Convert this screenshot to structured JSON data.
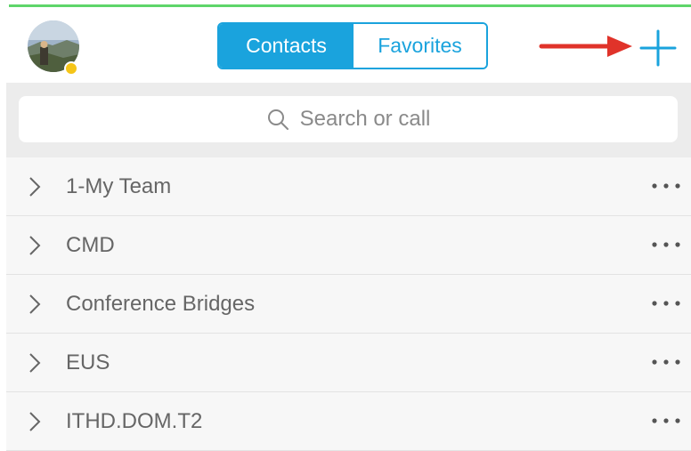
{
  "header": {
    "tabs": [
      {
        "label": "Contacts",
        "active": true
      },
      {
        "label": "Favorites",
        "active": false
      }
    ],
    "accent_color": "#1aa3dd",
    "presence_color": "#f5c518",
    "add_icon": "plus-icon",
    "annotation_arrow_color": "#e0332a"
  },
  "search": {
    "placeholder": "Search or call",
    "icon": "search-icon"
  },
  "groups": [
    {
      "label": "1-My Team"
    },
    {
      "label": "CMD"
    },
    {
      "label": "Conference Bridges"
    },
    {
      "label": "EUS"
    },
    {
      "label": "ITHD.DOM.T2"
    }
  ]
}
